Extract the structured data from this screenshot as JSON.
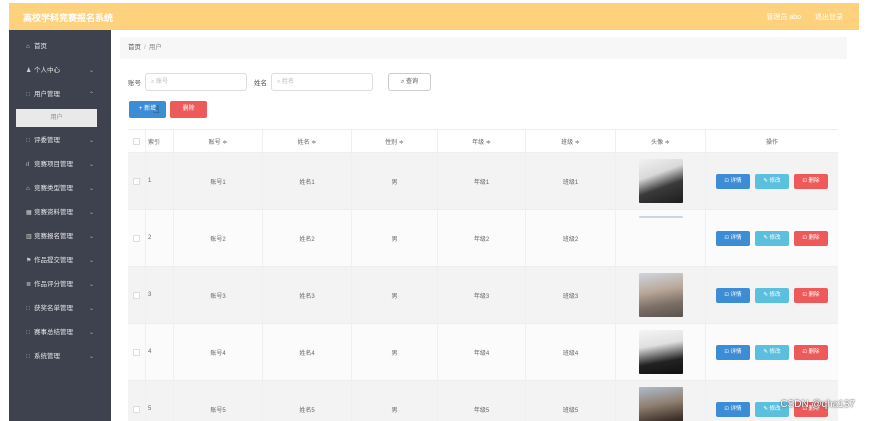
{
  "header": {
    "title": "高校学科竞赛报名系统",
    "admin": "管理员 abo",
    "logout": "退出登录"
  },
  "sidebar": {
    "items": [
      {
        "icon": "⌂",
        "label": "首页",
        "chevron": ""
      },
      {
        "icon": "♟",
        "label": "个人中心",
        "chevron": "⌄"
      },
      {
        "icon": "∷",
        "label": "用户管理",
        "chevron": "⌃"
      },
      {
        "icon": "∷",
        "label": "评委管理",
        "chevron": "⌄"
      },
      {
        "icon": "ıl",
        "label": "竞赛项目管理",
        "chevron": "⌄"
      },
      {
        "icon": "⌂",
        "label": "竞赛类型管理",
        "chevron": "⌄"
      },
      {
        "icon": "▦",
        "label": "竞赛资料管理",
        "chevron": "⌄"
      },
      {
        "icon": "▥",
        "label": "竞赛报名管理",
        "chevron": "⌄"
      },
      {
        "icon": "⚑",
        "label": "作品提交管理",
        "chevron": "⌄"
      },
      {
        "icon": "≣",
        "label": "作品评分管理",
        "chevron": "⌄"
      },
      {
        "icon": "∷",
        "label": "获奖名单管理",
        "chevron": "⌄"
      },
      {
        "icon": "∷",
        "label": "赛事总结管理",
        "chevron": "⌄"
      },
      {
        "icon": "∷",
        "label": "系统管理",
        "chevron": "⌄"
      }
    ],
    "active_sub": "用户"
  },
  "breadcrumb": {
    "home": "首页",
    "sep": "/",
    "current": "用户"
  },
  "search": {
    "account_label": "账号",
    "account_placeholder": "账号",
    "name_label": "姓名",
    "name_placeholder": "姓名",
    "query_label": "查询"
  },
  "actions": {
    "add": "+ 新增",
    "delete": "删除"
  },
  "table": {
    "headers": {
      "index": "索引",
      "account": "账号 ≑",
      "name": "姓名 ≑",
      "sex": "性别 ≑",
      "grade": "年级 ≑",
      "class": "班级 ≑",
      "avatar": "头像 ≑",
      "ops": "操作"
    },
    "rows": [
      {
        "index": "1",
        "account": "账号1",
        "name": "姓名1",
        "sex": "男",
        "grade": "年级1",
        "class": "班级1"
      },
      {
        "index": "2",
        "account": "账号2",
        "name": "姓名2",
        "sex": "男",
        "grade": "年级2",
        "class": "班级2"
      },
      {
        "index": "3",
        "account": "账号3",
        "name": "姓名3",
        "sex": "男",
        "grade": "年级3",
        "class": "班级3"
      },
      {
        "index": "4",
        "account": "账号4",
        "name": "姓名4",
        "sex": "男",
        "grade": "年级4",
        "class": "班级4"
      },
      {
        "index": "5",
        "account": "账号5",
        "name": "姓名5",
        "sex": "男",
        "grade": "年级5",
        "class": "班级5"
      }
    ],
    "op_labels": {
      "detail": "⊡ 详情",
      "edit": "✎ 修改",
      "delete": "⊡ 删除"
    }
  },
  "watermark": "CSDN @qha137",
  "colors": {
    "header": "#fed17d",
    "sidebar": "#3e424f",
    "primary": "#3c8dd5",
    "info": "#5bc0de",
    "danger": "#ee5a5a"
  }
}
